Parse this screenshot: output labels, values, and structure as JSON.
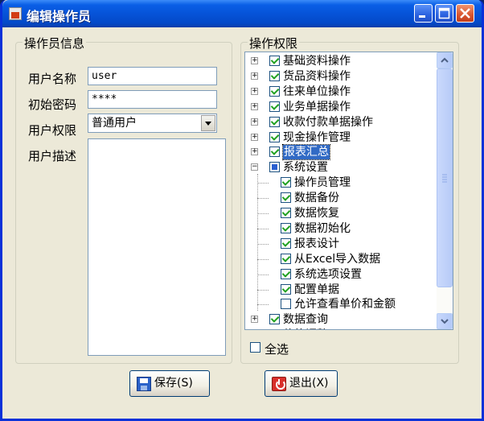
{
  "window": {
    "title": "编辑操作员"
  },
  "left_group": {
    "title": "操作员信息",
    "username_label": "用户名称",
    "username_value": "user",
    "password_label": "初始密码",
    "password_value": "****",
    "permission_label": "用户权限",
    "permission_value": "普通用户",
    "description_label": "用户描述"
  },
  "right_group": {
    "title": "操作权限",
    "tree": [
      {
        "label": "基础资料操作",
        "state": "checked",
        "expandable": true
      },
      {
        "label": "货品资料操作",
        "state": "checked",
        "expandable": true
      },
      {
        "label": "往来单位操作",
        "state": "checked",
        "expandable": true
      },
      {
        "label": "业务单据操作",
        "state": "checked",
        "expandable": true
      },
      {
        "label": "收款付款单据操作",
        "state": "checked",
        "expandable": true
      },
      {
        "label": "现金操作管理",
        "state": "checked",
        "expandable": true
      },
      {
        "label": "报表汇总",
        "state": "checked",
        "expandable": true,
        "selected": true
      },
      {
        "label": "系统设置",
        "state": "partial",
        "expandable": true,
        "expanded": true
      },
      {
        "label": "操作员管理",
        "state": "checked",
        "child": true
      },
      {
        "label": "数据备份",
        "state": "checked",
        "child": true
      },
      {
        "label": "数据恢复",
        "state": "checked",
        "child": true
      },
      {
        "label": "数据初始化",
        "state": "checked",
        "child": true
      },
      {
        "label": "报表设计",
        "state": "checked",
        "child": true
      },
      {
        "label": "从Excel导入数据",
        "state": "checked",
        "child": true
      },
      {
        "label": "系统选项设置",
        "state": "checked",
        "child": true
      },
      {
        "label": "配置单据",
        "state": "checked",
        "child": true
      },
      {
        "label": "允许查看单价和金额",
        "state": "unchecked",
        "child": true
      },
      {
        "label": "数据查询",
        "state": "checked",
        "expandable": true
      },
      {
        "label": "价格调整",
        "state": "checked",
        "expandable": true
      }
    ],
    "select_all_label": "全选"
  },
  "buttons": {
    "save_label": "保存(S)",
    "exit_label": "退出(X)"
  },
  "colors": {
    "titlebar": "#0653d8",
    "window_bg": "#ece9d8",
    "selection": "#316ac5",
    "check": "#21a121"
  }
}
